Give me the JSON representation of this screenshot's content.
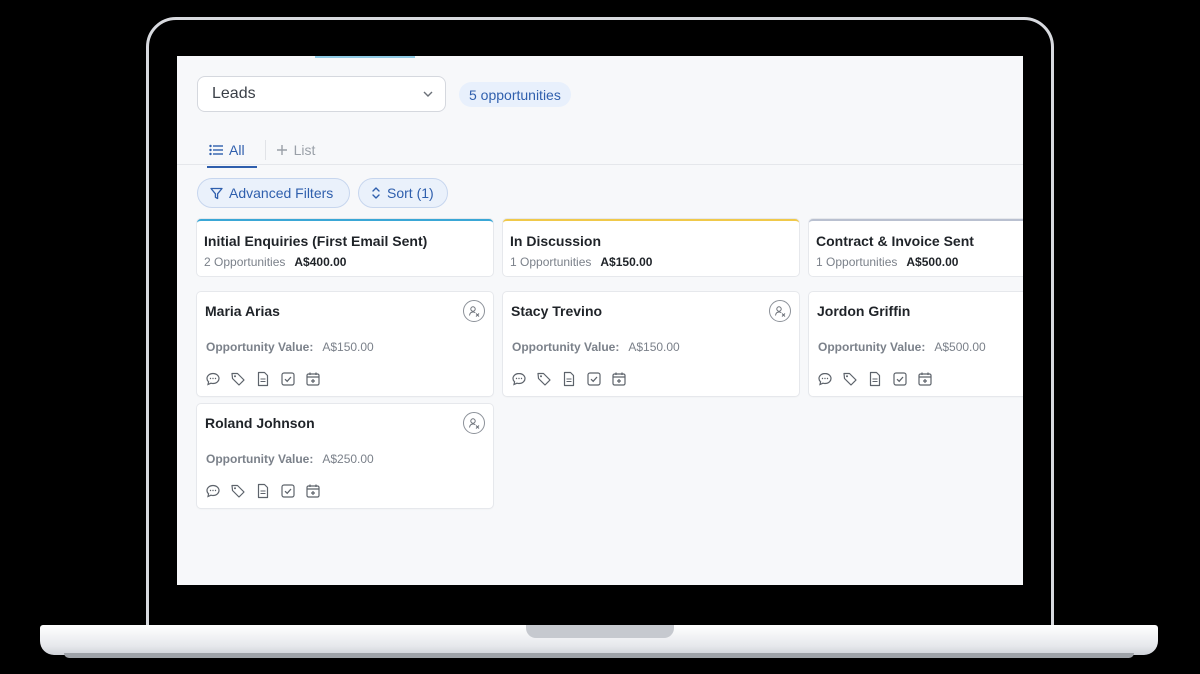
{
  "pipeline": {
    "selected": "Leads"
  },
  "opportunity_count": "5 opportunities",
  "tabs": {
    "all": "All",
    "list": "List"
  },
  "filters": {
    "advanced": "Advanced Filters",
    "sort": "Sort (1)"
  },
  "columns": [
    {
      "title": "Initial Enquiries (First Email Sent)",
      "count": "2 Opportunities",
      "total": "A$400.00",
      "accent": "#3aa7d6",
      "cards": [
        {
          "name": "Maria Arias",
          "value_label": "Opportunity Value:",
          "value": "A$150.00"
        },
        {
          "name": "Roland Johnson",
          "value_label": "Opportunity Value:",
          "value": "A$250.00"
        }
      ]
    },
    {
      "title": "In Discussion",
      "count": "1 Opportunities",
      "total": "A$150.00",
      "accent": "#f0c94a",
      "cards": [
        {
          "name": "Stacy Trevino",
          "value_label": "Opportunity Value:",
          "value": "A$150.00"
        }
      ]
    },
    {
      "title": "Contract & Invoice Sent",
      "count": "1 Opportunities",
      "total": "A$500.00",
      "accent": "#b9c0d0",
      "cards": [
        {
          "name": "Jordon Griffin",
          "value_label": "Opportunity Value:",
          "value": "A$500.00"
        }
      ]
    }
  ],
  "colors": {
    "primary": "#2f5fad",
    "badge_bg": "#e8f0fc"
  }
}
